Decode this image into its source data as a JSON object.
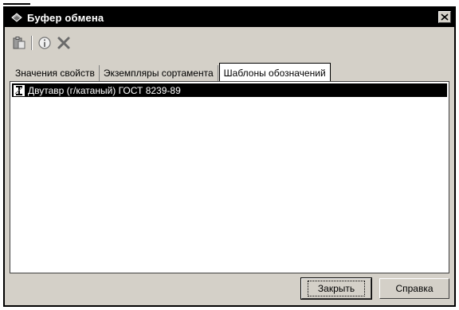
{
  "window": {
    "title": "Буфер обмена",
    "icon": "clipboard-app-icon"
  },
  "toolbar": {
    "items": [
      {
        "name": "paste",
        "icon": "paste-icon"
      },
      {
        "name": "properties",
        "icon": "info-icon"
      },
      {
        "name": "delete",
        "icon": "delete-x-icon"
      }
    ]
  },
  "tabs": [
    {
      "label": "Значения свойств",
      "active": false
    },
    {
      "label": "Экземпляры сортамента",
      "active": false
    },
    {
      "label": "Шаблоны обозначений",
      "active": true
    }
  ],
  "list": {
    "items": [
      {
        "label": "Двутавр (г/катаный) ГОСТ 8239-89",
        "selected": true,
        "icon": "i-beam-icon"
      }
    ]
  },
  "buttons": {
    "close_label": "Закрыть",
    "help_label": "Справка"
  }
}
